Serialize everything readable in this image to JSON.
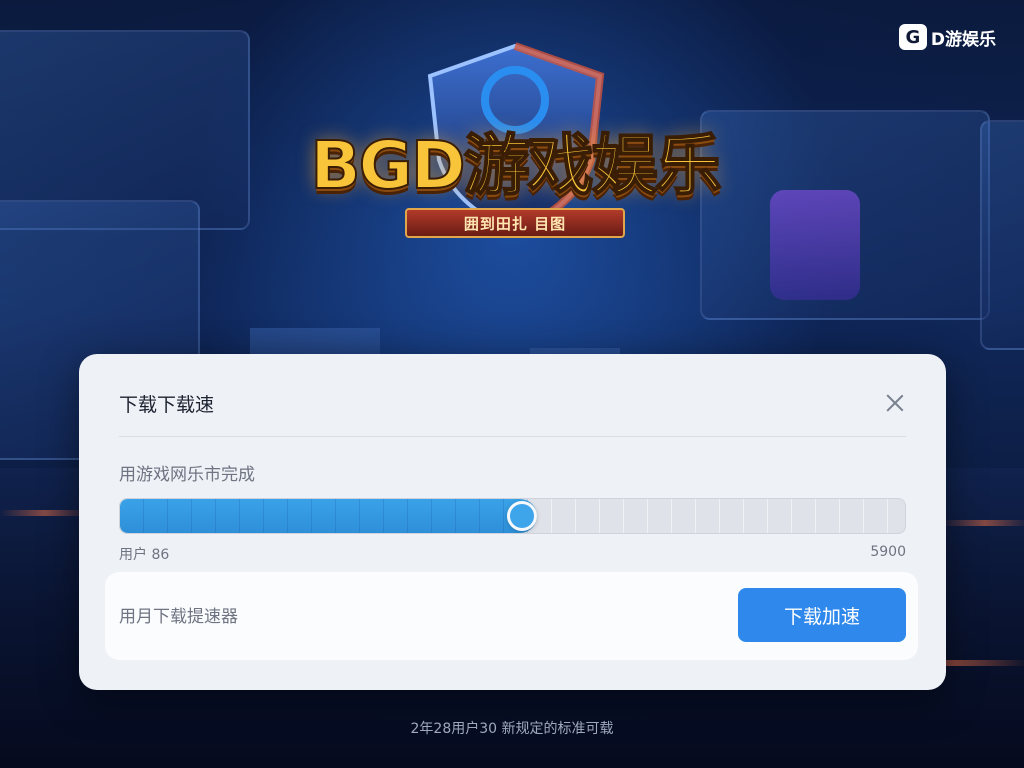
{
  "brand": {
    "corner_badge": "G",
    "corner_text": "D游娱乐",
    "logo_title": "BGD游戏娱乐",
    "logo_subtitle": "囲到田扎 目图"
  },
  "dialog": {
    "title": "下载下载速",
    "close_icon": "close-icon",
    "status": "用游戏网乐市完成",
    "progress": {
      "fraction": 0.53,
      "left_label": "用户 86",
      "right_label": "5900"
    },
    "footer_hint": "用月下载提速器",
    "primary_button": "下载加速"
  },
  "footer": {
    "text": "2年28用户30 新规定的标准可载"
  },
  "colors": {
    "accent": "#2f89ec",
    "progress_fill": "#3aa2e8",
    "dialog_bg": "#eef1f6",
    "logo_gold": "#f7c43a"
  }
}
